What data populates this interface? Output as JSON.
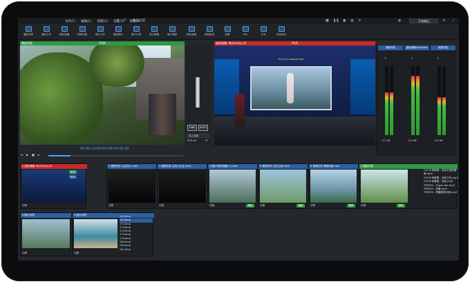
{
  "app": {
    "menus": [
      "文件(F)",
      "编辑(E)",
      "视图(V)",
      "设置(S)",
      "帮助(H)"
    ],
    "project_title": "我的工程",
    "output_button": "开始输出"
  },
  "toolbar": [
    {
      "label": "播放列表",
      "icon": "play-list-icon"
    },
    {
      "label": "播放文件",
      "icon": "file-icon"
    },
    {
      "label": "虚拟演播",
      "icon": "studio-icon"
    },
    {
      "label": "视频设备",
      "icon": "camera-icon"
    },
    {
      "label": "图片文件",
      "icon": "image-icon"
    },
    {
      "label": "播放图片",
      "icon": "picture-icon"
    },
    {
      "label": "图片列表",
      "icon": "image-list-icon"
    },
    {
      "label": "显示屏幕",
      "icon": "monitor-icon"
    },
    {
      "label": "窗口捕获",
      "icon": "window-icon"
    },
    {
      "label": "颜色画面",
      "icon": "color-icon"
    },
    {
      "label": "网络推流",
      "icon": "stream-icon"
    },
    {
      "label": "抠像",
      "icon": "keyer-icon"
    },
    {
      "label": "NDI",
      "icon": "ndi-icon"
    },
    {
      "label": "文本",
      "icon": "text-icon"
    },
    {
      "label": "添加更多",
      "icon": "plus-icon"
    }
  ],
  "preview": {
    "header": "PVW",
    "source_tag": "播放列表",
    "timecode": "00:00:12/00:05:42/00:05:30",
    "colors": {
      "header": "#2e9b43"
    }
  },
  "program": {
    "header": "PGM",
    "source_tag": "虚拟演播: MyStudio_03",
    "stage_text": "This is a sample text",
    "colors": {
      "header": "#c92a2a"
    }
  },
  "transition": {
    "take": "TAKE",
    "auto": "AUTO",
    "type": "淡入淡出",
    "duration": "950 ms"
  },
  "audio": {
    "tabs": [
      "播放列表",
      "虚拟演播:MyStudio",
      "播放列表"
    ],
    "channels": [
      {
        "label": "L",
        "db": "0.0 dB",
        "level": 0.62
      },
      {
        "label": "L",
        "db": "0.0 dB",
        "level": 0.86
      },
      {
        "label": "L",
        "db": "0.0 dB",
        "level": 0.55
      }
    ]
  },
  "sources": [
    {
      "title": "1 虚拟演播: MyStudio_03",
      "name_color": "#c92a2a",
      "footer": "切换",
      "tab": "机位",
      "tab2": "特写"
    },
    {
      "title": "2 视频文件 女主持人.mp4",
      "name_color": "#2b5fa0",
      "footer": "切换"
    },
    {
      "title": "3 视频文件 主持人女生.mp4",
      "name_color": "#2b5fa0",
      "footer": "切换"
    },
    {
      "title": "4 图片切换(图像) 1.mp4",
      "name_color": "#2b5fa0",
      "footer": "切换",
      "button": "播放"
    },
    {
      "title": "5 视频文件 天空之城.mp4",
      "name_color": "#2b5fa0",
      "footer": "切换",
      "button": "播放"
    },
    {
      "title": "6 视频文件 美丽风景.mp4",
      "name_color": "#2b5fa0",
      "footer": "切换",
      "button": "播放"
    },
    {
      "title": "7 播放列表",
      "name_color": "#2e9b43",
      "footer": "切换",
      "button": "播放"
    }
  ],
  "playlist": [
    "G.E.M.邓紫棋 - 来自天堂的魔鬼.mp3",
    "G.E.M.邓紫棋 - 光年之外.mp3",
    "G.E.M.邓紫棋 - 泡沫.mp3",
    "TFBOYS - Super star.mp3",
    "TFBOYS - 宠爱.mp3",
    "TFBOYS - 青春修炼手册.mp3"
  ],
  "lower": {
    "panel1_title": "8 图片列表",
    "panel2_title": "9 图片列表",
    "footer": "切换",
    "files": [
      "100.bmp",
      "107.bmp",
      "172.bmp",
      "173.bmp",
      "174.bmp",
      "175.bmp",
      "176.bmp",
      "180.bmp",
      "240.bmp",
      "241.bmp"
    ]
  }
}
